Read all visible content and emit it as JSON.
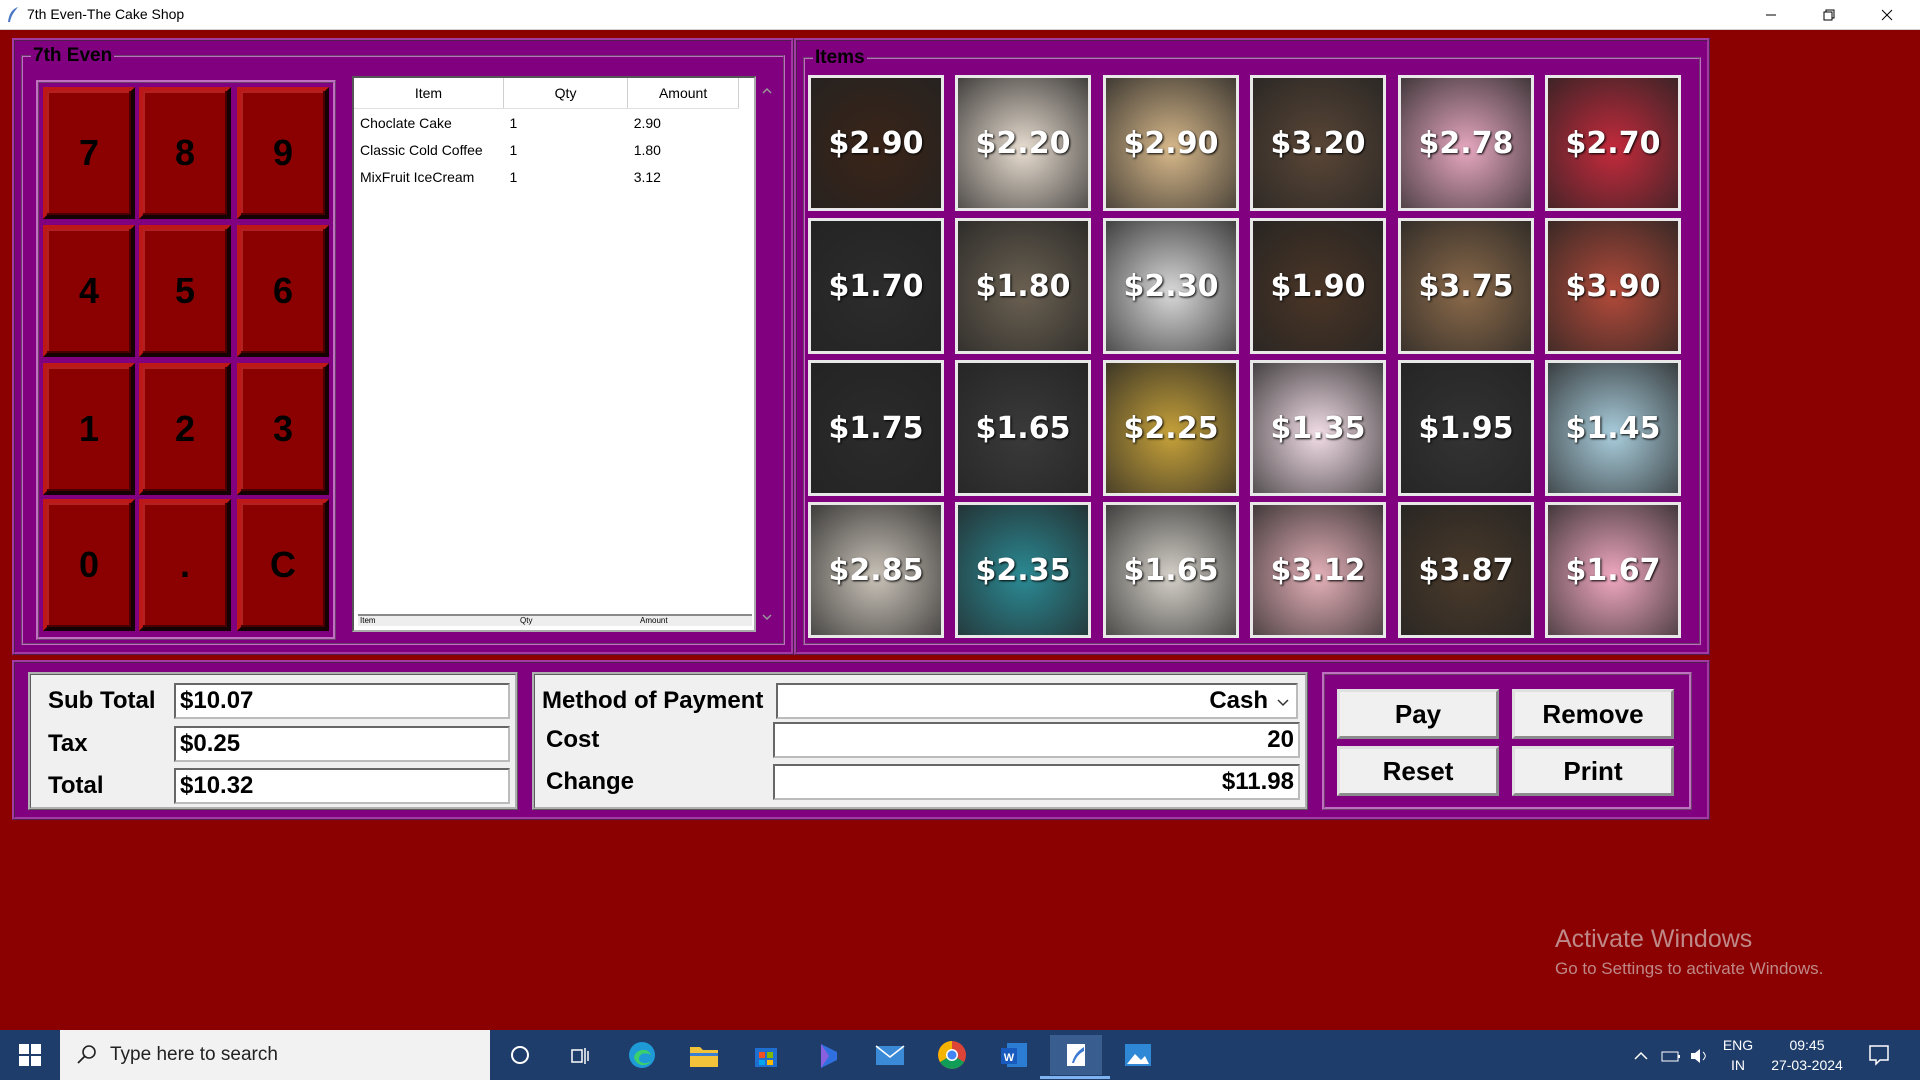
{
  "window": {
    "title": "7th Even-The Cake Shop"
  },
  "keypad": {
    "label": "7th Even",
    "keys": [
      "7",
      "8",
      "9",
      "4",
      "5",
      "6",
      "1",
      "2",
      "3",
      "0",
      ".",
      "C"
    ]
  },
  "receipt": {
    "columns": [
      "Item",
      "Qty",
      "Amount"
    ],
    "rows": [
      {
        "item": "Choclate Cake",
        "qty": "1",
        "amount": "2.90"
      },
      {
        "item": "Classic Cold Coffee",
        "qty": "1",
        "amount": "1.80"
      },
      {
        "item": "MixFruit IceCream",
        "qty": "1",
        "amount": "3.12"
      }
    ],
    "footer": [
      "Item",
      "Qty",
      "Amount"
    ]
  },
  "items": {
    "label": "Items",
    "tiles": [
      {
        "price": "$2.90",
        "color": "#3a2418"
      },
      {
        "price": "$2.20",
        "color": "#e8ddd0"
      },
      {
        "price": "$2.90",
        "color": "#d7b88a"
      },
      {
        "price": "$3.20",
        "color": "#5a4636"
      },
      {
        "price": "$2.78",
        "color": "#e6a7bf"
      },
      {
        "price": "$2.70",
        "color": "#c42a3c"
      },
      {
        "price": "$1.70",
        "color": "#2c2c2c"
      },
      {
        "price": "$1.80",
        "color": "#6b6152"
      },
      {
        "price": "$2.30",
        "color": "#d9d9d9"
      },
      {
        "price": "$1.90",
        "color": "#4a3526"
      },
      {
        "price": "$3.75",
        "color": "#8b6a4a"
      },
      {
        "price": "$3.90",
        "color": "#b24a3a"
      },
      {
        "price": "$1.75",
        "color": "#2b2b2b"
      },
      {
        "price": "$1.65",
        "color": "#3a3a3a"
      },
      {
        "price": "$2.25",
        "color": "#c7a23a"
      },
      {
        "price": "$1.35",
        "color": "#f2dde6"
      },
      {
        "price": "$1.95",
        "color": "#333333"
      },
      {
        "price": "$1.45",
        "color": "#a9cddc"
      },
      {
        "price": "$2.85",
        "color": "#c9c2b8"
      },
      {
        "price": "$2.35",
        "color": "#2b8a94"
      },
      {
        "price": "$1.65",
        "color": "#d4d0c8"
      },
      {
        "price": "$3.12",
        "color": "#e4b0b8"
      },
      {
        "price": "$3.87",
        "color": "#4a3a2a"
      },
      {
        "price": "$1.67",
        "color": "#f0a8c0"
      }
    ]
  },
  "totals": {
    "sub_total_label": "Sub Total",
    "sub_total": "$10.07",
    "tax_label": "Tax",
    "tax": "$0.25",
    "total_label": "Total",
    "total": "$10.32"
  },
  "payment": {
    "method_label": "Method of Payment",
    "method_value": "Cash",
    "cost_label": "Cost",
    "cost_value": "20",
    "change_label": "Change",
    "change_value": "$11.98"
  },
  "actions": {
    "pay": "Pay",
    "remove": "Remove",
    "reset": "Reset",
    "print": "Print"
  },
  "watermark": {
    "line1": "Activate Windows",
    "line2": "Go to Settings to activate Windows."
  },
  "taskbar": {
    "search_placeholder": "Type here to search",
    "lang_top": "ENG",
    "lang_bottom": "IN",
    "time": "09:45",
    "date": "27-03-2024"
  },
  "colors": {
    "background": "#8b0000",
    "panel": "#800080",
    "taskbar": "#1f3d6b"
  }
}
